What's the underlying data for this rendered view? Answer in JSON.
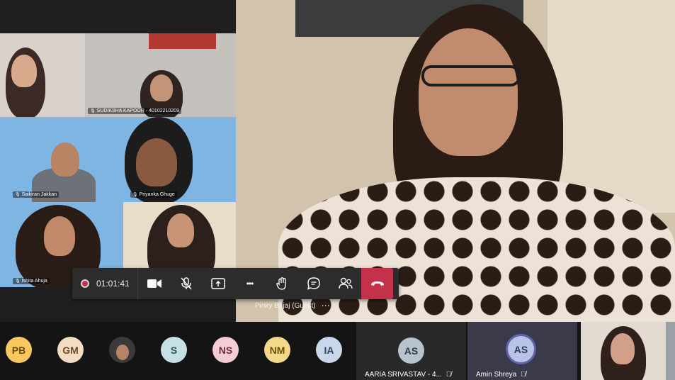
{
  "grid": {
    "participants": [
      {
        "name": ""
      },
      {
        "name": "SUDIKSHA KAPOOR - 40102210209"
      },
      {
        "name": "Saikiran Jakkan"
      },
      {
        "name": "Priyanka Ghuge"
      },
      {
        "name": "Ishita Ahuja"
      },
      {
        "name": ""
      }
    ]
  },
  "main_speaker": {
    "name": "Pinky Bajaj (Guest)",
    "more_label": "⋯"
  },
  "controls": {
    "timer": "01:01:41",
    "more_label": "•••"
  },
  "strip": {
    "avatars": [
      {
        "initials": "PB",
        "bg": "#f6c85f",
        "fg": "#6b4a00"
      },
      {
        "initials": "GM",
        "bg": "#f3dcc2",
        "fg": "#6a4a2a"
      },
      {
        "initials": "",
        "bg": "#3a3a3a",
        "fg": "#ffffff"
      },
      {
        "initials": "S",
        "bg": "#c7e0e6",
        "fg": "#2b5461"
      },
      {
        "initials": "NS",
        "bg": "#f3cdd3",
        "fg": "#6e2c39"
      },
      {
        "initials": "NM",
        "bg": "#f5d98a",
        "fg": "#6b5200"
      },
      {
        "initials": "IA",
        "bg": "#c8d7ea",
        "fg": "#2a4666"
      }
    ],
    "tiles": [
      {
        "initials": "AS",
        "name": "AARIA SRIVASTAV - 4..."
      },
      {
        "initials": "AS",
        "name": "Amin Shreya"
      }
    ]
  },
  "colors": {
    "accent": "#6264a7",
    "hangup": "#c4314b",
    "bar": "#2d2c2c"
  }
}
